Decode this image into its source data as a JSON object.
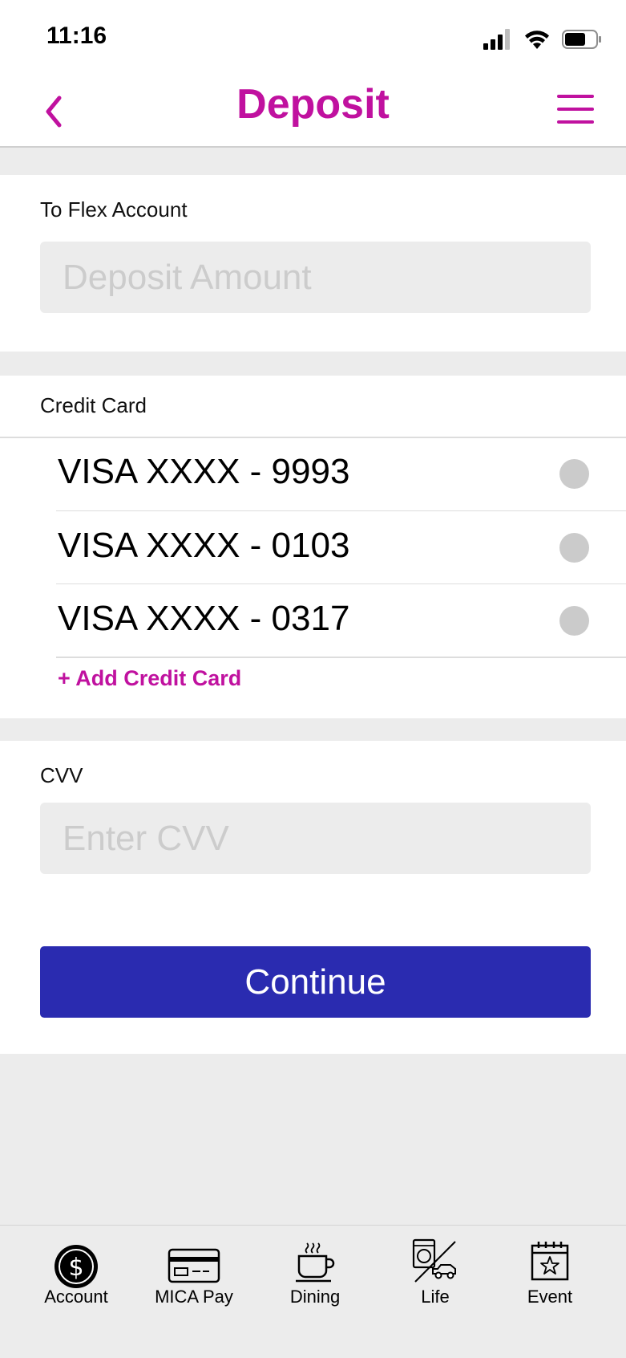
{
  "status_bar": {
    "time": "11:16"
  },
  "header": {
    "title": "Deposit"
  },
  "deposit": {
    "section_label": "To Flex Account",
    "amount_placeholder": "Deposit Amount",
    "amount_value": ""
  },
  "credit_card": {
    "section_label": "Credit Card",
    "cards": [
      {
        "label": "VISA XXXX - 9993",
        "selected": false
      },
      {
        "label": "VISA XXXX - 0103",
        "selected": false
      },
      {
        "label": "VISA XXXX - 0317",
        "selected": false
      }
    ],
    "add_label": "+ Add Credit Card"
  },
  "cvv": {
    "section_label": "CVV",
    "placeholder": "Enter CVV",
    "value": ""
  },
  "actions": {
    "continue_label": "Continue"
  },
  "tab_bar": {
    "tabs": [
      {
        "label": "Account",
        "icon": "dollar-coin-icon"
      },
      {
        "label": "MICA Pay",
        "icon": "credit-card-icon"
      },
      {
        "label": "Dining",
        "icon": "coffee-cup-icon"
      },
      {
        "label": "Life",
        "icon": "laundry-car-icon"
      },
      {
        "label": "Event",
        "icon": "calendar-star-icon"
      }
    ]
  },
  "colors": {
    "accent": "#c0119f",
    "primary_button": "#2a2bb0",
    "background": "#ececec"
  }
}
